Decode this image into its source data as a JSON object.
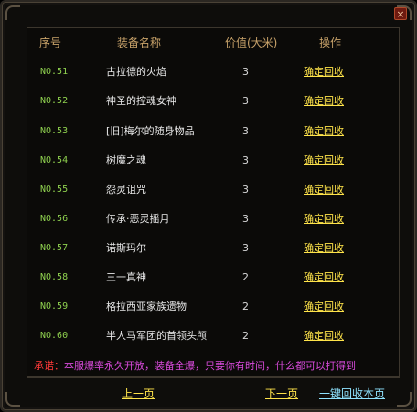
{
  "header": {
    "seq": "序号",
    "name": "装备名称",
    "value": "价值(大米)",
    "action": "操作"
  },
  "rows": [
    {
      "no": "NO.51",
      "name": "古拉德的火焰",
      "value": "3",
      "action": "确定回收"
    },
    {
      "no": "NO.52",
      "name": "神圣的控魂女神",
      "value": "3",
      "action": "确定回收"
    },
    {
      "no": "NO.53",
      "name": "[旧]梅尔的随身物品",
      "value": "3",
      "action": "确定回收"
    },
    {
      "no": "NO.54",
      "name": "树魔之魂",
      "value": "3",
      "action": "确定回收"
    },
    {
      "no": "NO.55",
      "name": "怨灵诅咒",
      "value": "3",
      "action": "确定回收"
    },
    {
      "no": "NO.56",
      "name": "传承·恶灵摇月",
      "value": "3",
      "action": "确定回收"
    },
    {
      "no": "NO.57",
      "name": "诺斯玛尔",
      "value": "3",
      "action": "确定回收"
    },
    {
      "no": "NO.58",
      "name": "三一真神",
      "value": "2",
      "action": "确定回收"
    },
    {
      "no": "NO.59",
      "name": "格拉西亚家族遗物",
      "value": "2",
      "action": "确定回收"
    },
    {
      "no": "NO.60",
      "name": "半人马军团的首领头颅",
      "value": "2",
      "action": "确定回收"
    }
  ],
  "notice": {
    "label": "承诺：",
    "text": "本服爆率永久开放，装备全爆，只要你有时间，什么都可以打得到"
  },
  "footer": {
    "prev": "上一页",
    "next": "下一页",
    "recycle_all": "一键回收本页"
  },
  "window": {
    "close_glyph": "×"
  }
}
